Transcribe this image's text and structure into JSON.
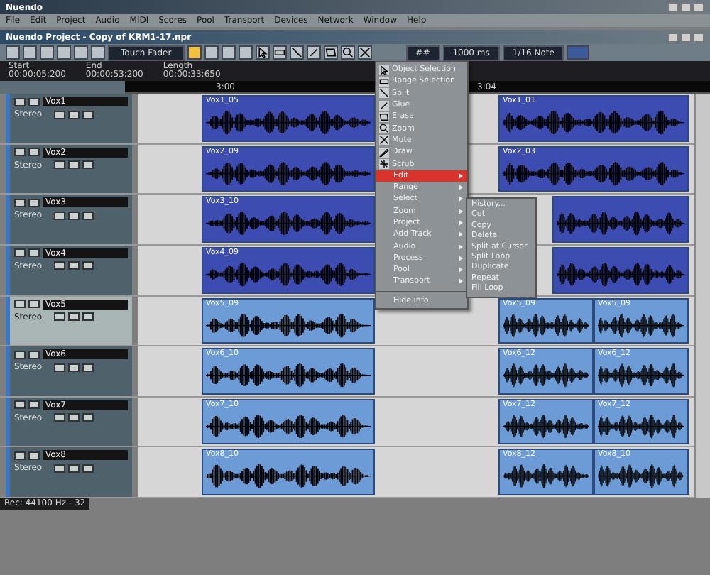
{
  "app_title": "Nuendo",
  "menu": [
    "File",
    "Edit",
    "Project",
    "Audio",
    "MIDI",
    "Scores",
    "Pool",
    "Transport",
    "Devices",
    "Network",
    "Window",
    "Help"
  ],
  "project": {
    "title": "Nuendo Project - Copy of KRM1-17.npr"
  },
  "toolbar": {
    "automation_mode": "Touch Fader",
    "snap": "##",
    "grid": "1000 ms",
    "quantize": "1/16 Note"
  },
  "info_line": [
    {
      "label": "Start",
      "value": "00:00:05:200"
    },
    {
      "label": "End",
      "value": "00:00:53:200"
    },
    {
      "label": "Length",
      "value": "00:00:33:650"
    }
  ],
  "ruler": [
    "3:00",
    "3:04"
  ],
  "tracks": [
    {
      "name": "Vox1",
      "type": "Stereo",
      "selected": false,
      "events": [
        {
          "label": "Vox1_05",
          "selected": true
        },
        {
          "label": "Vox1_01",
          "selected": true
        }
      ]
    },
    {
      "name": "Vox2",
      "type": "Stereo",
      "selected": false,
      "events": [
        {
          "label": "Vox2_09",
          "selected": true
        },
        {
          "label": "Vox2_03",
          "selected": true
        }
      ]
    },
    {
      "name": "Vox3",
      "type": "Stereo",
      "selected": false,
      "events": [
        {
          "label": "Vox3_10",
          "selected": true
        },
        {
          "selected": true
        }
      ]
    },
    {
      "name": "Vox4",
      "type": "Stereo",
      "selected": false,
      "events": [
        {
          "label": "Vox4_09",
          "selected": true
        },
        {
          "selected": true
        }
      ]
    },
    {
      "name": "Vox5",
      "type": "Stereo",
      "selected": true,
      "events": [
        {
          "label": "Vox5_09",
          "selected": false
        },
        {
          "label": "Vox5_09",
          "selected": false
        },
        {
          "label": "Vox5_09",
          "selected": false
        }
      ]
    },
    {
      "name": "Vox6",
      "type": "Stereo",
      "selected": false,
      "events": [
        {
          "label": "Vox6_10",
          "selected": false
        },
        {
          "label": "Vox6_12",
          "selected": false
        },
        {
          "label": "Vox6_12",
          "selected": false
        }
      ]
    },
    {
      "name": "Vox7",
      "type": "Stereo",
      "selected": false,
      "events": [
        {
          "label": "Vox7_10",
          "selected": false
        },
        {
          "label": "Vox7_12",
          "selected": false
        },
        {
          "label": "Vox7_12",
          "selected": false
        }
      ]
    },
    {
      "name": "Vox8",
      "type": "Stereo",
      "selected": false,
      "events": [
        {
          "label": "Vox8_10",
          "selected": false
        },
        {
          "label": "Vox8_12",
          "selected": false
        },
        {
          "label": "Vox8_10",
          "selected": false
        }
      ]
    }
  ],
  "context_menu": [
    {
      "label": "Object Selection",
      "kind": "tool",
      "selected": false
    },
    {
      "label": "Range Selection",
      "kind": "tool",
      "selected": false
    },
    {
      "label": "Split",
      "kind": "tool",
      "selected": false
    },
    {
      "label": "Glue",
      "kind": "tool",
      "selected": false
    },
    {
      "label": "Erase",
      "kind": "tool",
      "selected": false
    },
    {
      "label": "Zoom",
      "kind": "tool",
      "selected": false
    },
    {
      "label": "Mute",
      "kind": "tool",
      "selected": false
    },
    {
      "label": "Draw",
      "kind": "tool",
      "selected": false
    },
    {
      "label": "Scrub",
      "kind": "tool",
      "selected": false
    },
    {
      "label": "Edit",
      "kind": "submenu",
      "selected": true
    },
    {
      "label": "Range",
      "kind": "submenu",
      "selected": false
    },
    {
      "label": "Select",
      "kind": "submenu",
      "selected": false
    },
    {
      "label": "Zoom",
      "kind": "submenu",
      "selected": false
    },
    {
      "label": "Project",
      "kind": "submenu",
      "selected": false
    },
    {
      "label": "Add Track",
      "kind": "submenu",
      "selected": false
    },
    {
      "label": "Audio",
      "kind": "submenu",
      "selected": false
    },
    {
      "label": "Process",
      "kind": "submenu",
      "selected": false
    },
    {
      "label": "Pool",
      "kind": "submenu",
      "selected": false
    },
    {
      "label": "Transport",
      "kind": "submenu",
      "selected": false
    },
    {
      "label": "Hide Info",
      "kind": "command",
      "selected": false
    }
  ],
  "submenu": [
    "History...",
    "Cut",
    "Copy",
    "Delete",
    "Split at Cursor",
    "Split Loop",
    "Duplicate",
    "Repeat",
    "Fill Loop"
  ],
  "status_bar": "Rec: 44100 Hz - 32"
}
